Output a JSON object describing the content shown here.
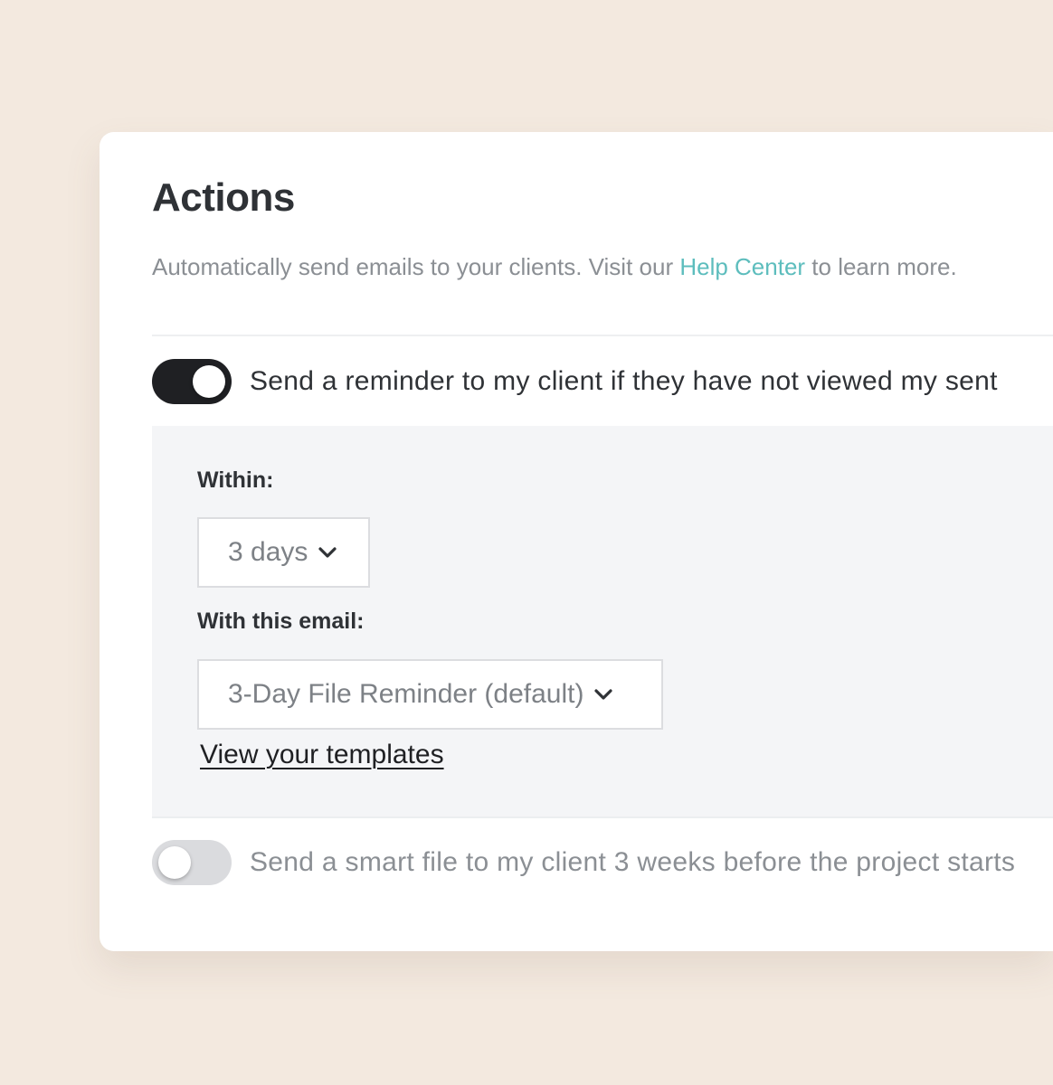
{
  "actions": {
    "title": "Actions",
    "subtitle_before": "Automatically send emails to your clients. Visit our ",
    "help_link": "Help Center",
    "subtitle_after": " to learn more.",
    "reminder": {
      "toggle_on": true,
      "label": "Send a reminder to my client if they have not viewed my sent",
      "within_label": "Within:",
      "within_value": "3 days",
      "email_label": "With this email:",
      "email_value": "3-Day File Reminder (default)",
      "templates_link": "View your templates"
    },
    "smart_file": {
      "toggle_on": false,
      "label": "Send a smart file to my client 3 weeks before the project starts"
    }
  },
  "colors": {
    "background": "#f3e9df",
    "accent_link": "#5dbdbd",
    "toggle_on": "#1f2023",
    "toggle_off": "#dadbde"
  },
  "icons": {
    "select_chevron": "chevron-down-icon"
  }
}
